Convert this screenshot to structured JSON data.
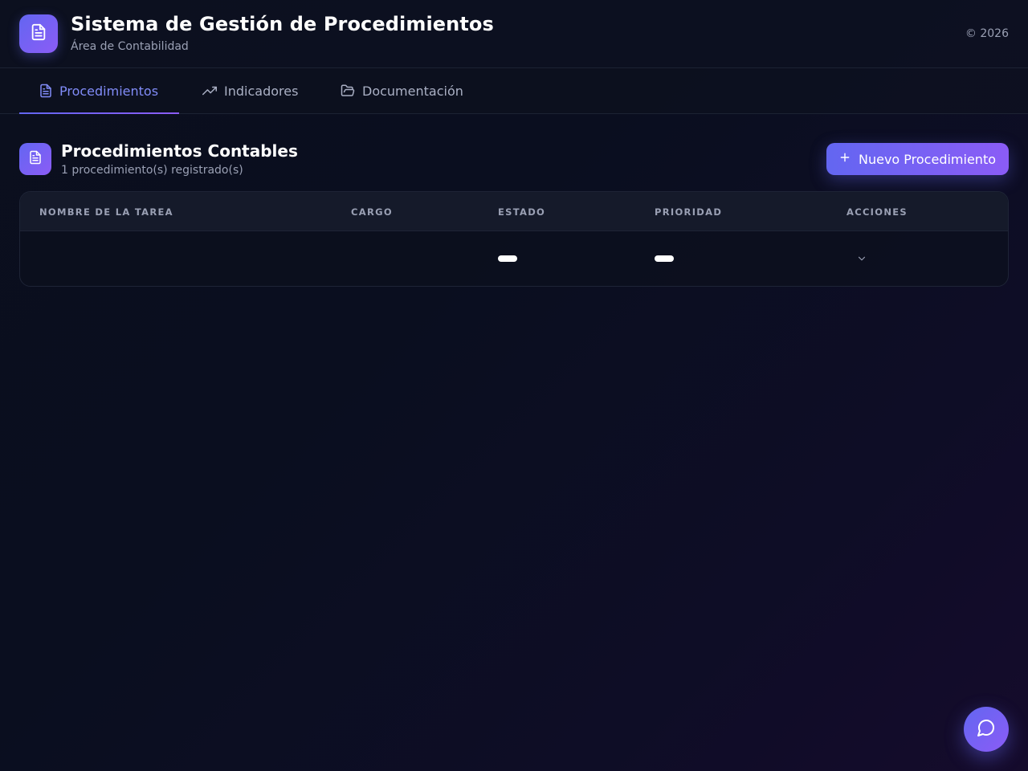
{
  "header": {
    "title": "Sistema de Gestión de Procedimientos",
    "subtitle": "Área de Contabilidad",
    "copyright": "© 2026",
    "logo_icon": "file-text-icon"
  },
  "tabs": [
    {
      "label": "Procedimientos",
      "icon": "file-text-icon",
      "active": true
    },
    {
      "label": "Indicadores",
      "icon": "trending-up-icon",
      "active": false
    },
    {
      "label": "Documentación",
      "icon": "folder-open-icon",
      "active": false
    }
  ],
  "section": {
    "title": "Procedimientos Contables",
    "count_text": "1 procedimiento(s) registrado(s)",
    "new_button_label": "Nuevo Procedimiento",
    "new_button_icon": "plus-icon"
  },
  "table": {
    "columns": [
      "NOMBRE DE LA TAREA",
      "CARGO",
      "ESTADO",
      "PRIORIDAD",
      "ACCIONES"
    ],
    "rows": [
      {
        "nombre": "",
        "cargo": "",
        "estado": "",
        "prioridad": "",
        "acciones_icon": "chevron-down-icon"
      }
    ]
  },
  "chat_fab": {
    "icon": "message-circle-icon"
  },
  "colors": {
    "accent": "#6366f1",
    "accent_2": "#8b5cf6",
    "background": "#0b0f1e",
    "muted_text": "#9aa0b4"
  }
}
